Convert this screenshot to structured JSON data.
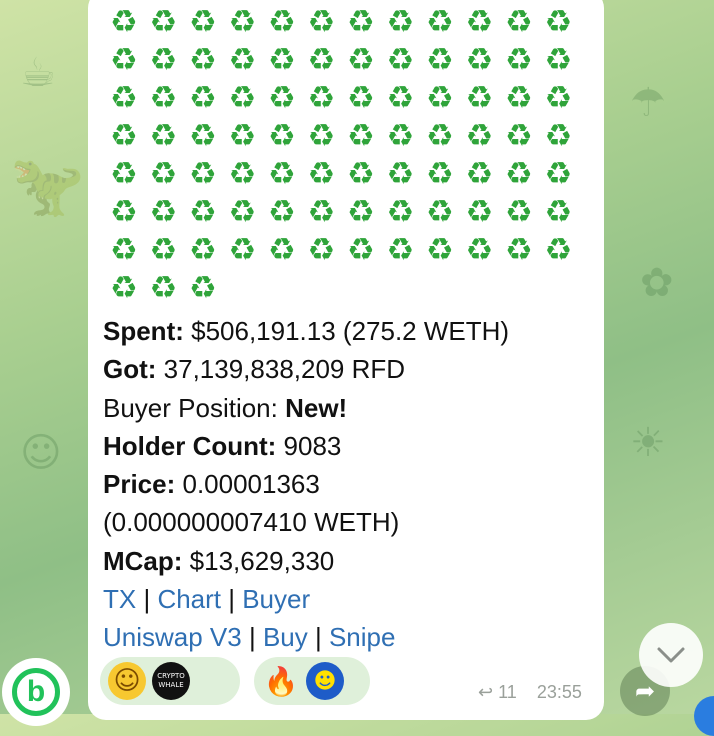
{
  "recycle": {
    "glyph": "♻",
    "count": 87,
    "color": "#2fa43a"
  },
  "message": {
    "spent_label": "Spent:",
    "spent_value": " $506,191.13 (275.2 WETH)",
    "got_label": "Got:",
    "got_value": " 37,139,838,209 RFD",
    "position_label": "Buyer Position: ",
    "position_value": "New!",
    "holder_label": "Holder Count:",
    "holder_value": " 9083",
    "price_label": "Price:",
    "price_value": " 0.00001363",
    "price_weth": "(0.000000007410 WETH)",
    "mcap_label": "MCap:",
    "mcap_value": " $13,629,330",
    "links_row1": [
      "TX",
      "Chart",
      "Buyer"
    ],
    "links_row2": [
      "Uniswap V3",
      "Buy",
      "Snipe"
    ],
    "separator": " | "
  },
  "reactions": {
    "group1": {
      "icons": [
        "grinning-face-emoji",
        "crypto-whale-avatar"
      ],
      "whale_text": [
        "CRYPTO",
        "WHALE"
      ]
    },
    "group2": {
      "icons": [
        "fire-emoji",
        "pepe-avatar"
      ]
    }
  },
  "meta": {
    "reply_count": "11",
    "time": "23:55"
  },
  "colors": {
    "link": "#2f6fb3",
    "bubble": "#ffffff",
    "reaction_bg": "#dff0da",
    "avatar_ring": "#21c25a"
  },
  "avatar": {
    "letter": "b"
  }
}
